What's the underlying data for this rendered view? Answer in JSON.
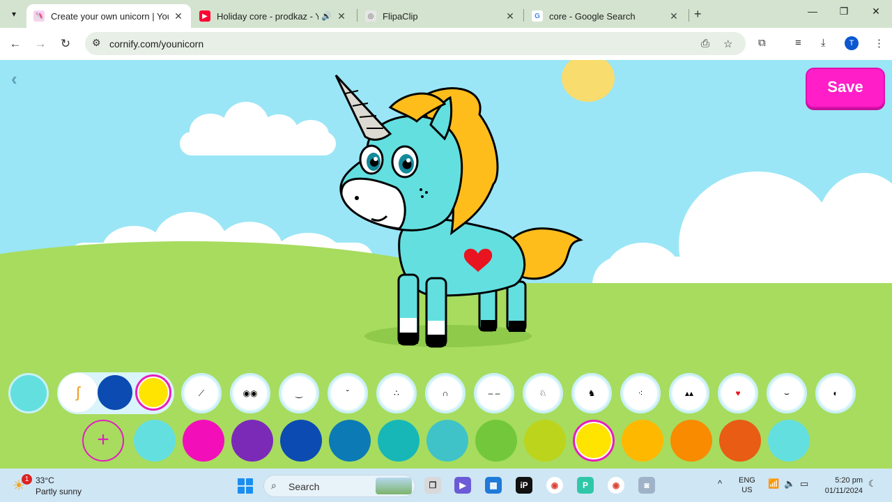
{
  "browser": {
    "tabs": [
      {
        "title": "Create your own unicorn | Youni",
        "active": true,
        "icon": "cornify-icon"
      },
      {
        "title": "Holiday core - prodkaz - Yo",
        "active": false,
        "icon": "youtube-icon",
        "audio": true
      },
      {
        "title": "FlipaClip",
        "active": false,
        "icon": "flipaclip-icon"
      },
      {
        "title": "core - Google Search",
        "active": false,
        "icon": "google-icon"
      }
    ],
    "url": "cornify.com/younicorn",
    "profile_initial": "T"
  },
  "page": {
    "save_label": "Save",
    "accent_color": "#ff1ec8",
    "sky_color": "#9ae6f6",
    "grass_color": "#a7dc5f"
  },
  "part_options": [
    "hair",
    "horn",
    "eyes",
    "mouth-1",
    "mouth-2",
    "mouth-3",
    "ear",
    "brows",
    "body",
    "body-2",
    "spikes-1",
    "spikes-2",
    "heart-mark",
    "smile",
    "background"
  ],
  "selected_body_color": "#63dfe0",
  "hair_colors": [
    "#0b4bb2",
    "#ffe400"
  ],
  "color_palette": [
    "#63dfe0",
    "#f20fba",
    "#7b2ab8",
    "#0b4bb2",
    "#0c7ab5",
    "#17b7b8",
    "#3fc3c8",
    "#72c83a",
    "#bcd41c",
    "#ffe400",
    "#ffb800",
    "#f88b00",
    "#e85c14",
    "#63dfe0"
  ],
  "taskbar": {
    "weather_temp": "33°C",
    "weather_desc": "Partly sunny",
    "weather_badge": "1",
    "search_label": "Search",
    "lang_1": "ENG",
    "lang_2": "US",
    "time": "5:20 pm",
    "date": "01/11/2024"
  }
}
